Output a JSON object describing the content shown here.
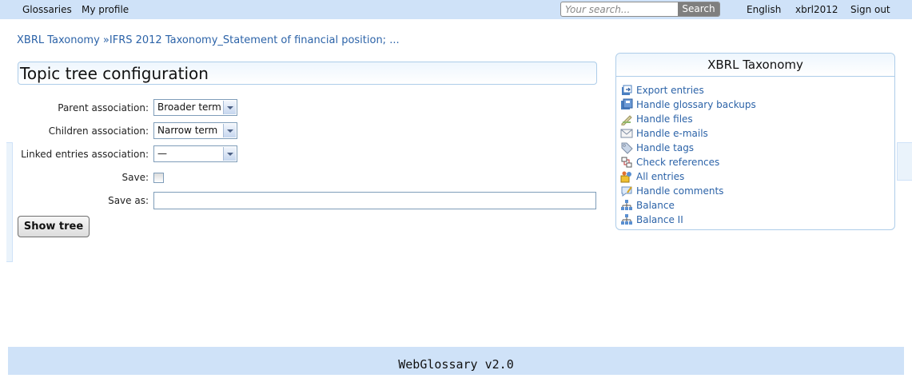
{
  "nav": {
    "glossaries": "Glossaries",
    "my_profile": "My profile",
    "search_placeholder": "Your search...",
    "search_button": "Search",
    "language": "English",
    "user": "xbrl2012",
    "sign_out": "Sign out"
  },
  "breadcrumb": {
    "root": "XBRL Taxonomy",
    "separator": " »",
    "current": "IFRS 2012 Taxonomy_Statement of financial position; ..."
  },
  "page": {
    "title": "Topic tree configuration"
  },
  "form": {
    "parent_label": "Parent association:",
    "parent_value": "Broader term",
    "children_label": "Children association:",
    "children_value": "Narrow term",
    "linked_label": "Linked entries association:",
    "linked_value": "—",
    "save_label": "Save:",
    "save_checked": false,
    "save_as_label": "Save as:",
    "save_as_value": "",
    "show_tree_button": "Show tree"
  },
  "sidebar": {
    "title": "XBRL Taxonomy",
    "items": [
      {
        "label": "Export entries",
        "icon": "export-icon"
      },
      {
        "label": "Handle glossary backups",
        "icon": "backup-icon"
      },
      {
        "label": "Handle files",
        "icon": "files-icon"
      },
      {
        "label": "Handle e-mails",
        "icon": "mail-icon"
      },
      {
        "label": "Handle tags",
        "icon": "tag-icon"
      },
      {
        "label": "Check references",
        "icon": "references-icon"
      },
      {
        "label": "All entries",
        "icon": "entries-icon"
      },
      {
        "label": "Handle comments",
        "icon": "comments-icon"
      },
      {
        "label": "Balance",
        "icon": "tree-icon"
      },
      {
        "label": "Balance II",
        "icon": "tree-icon"
      }
    ]
  },
  "footer": {
    "text": "WebGlossary v2.0"
  },
  "colors": {
    "bar": "#cfe2f8",
    "link": "#2c63a8",
    "border": "#aecde9"
  }
}
